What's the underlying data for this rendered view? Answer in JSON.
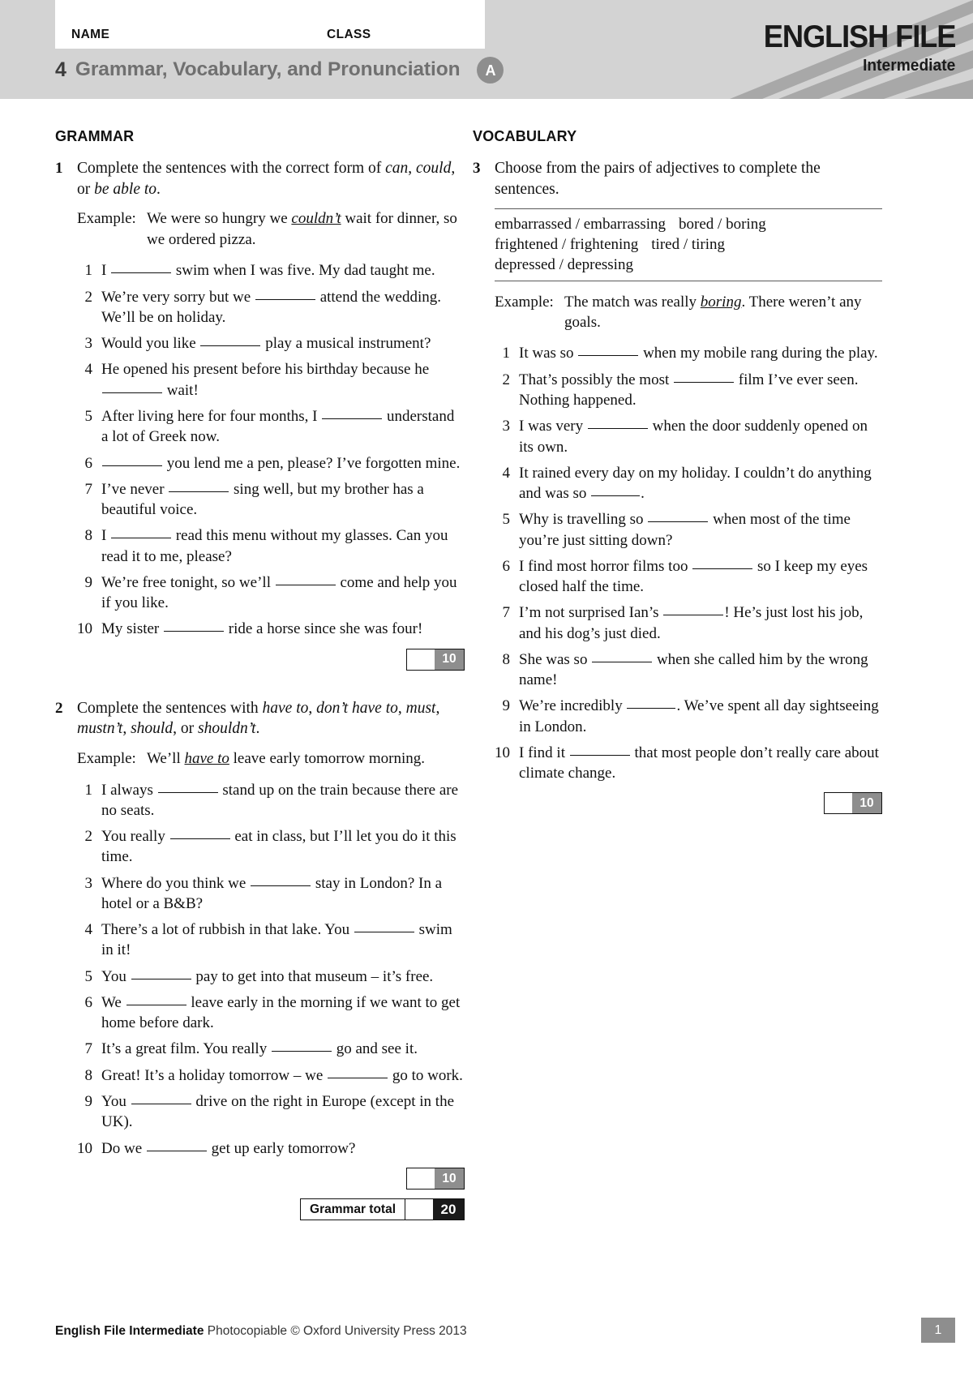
{
  "header": {
    "name_label": "NAME",
    "class_label": "CLASS",
    "unit_number": "4",
    "title": "Grammar, Vocabulary, and Pronunciation",
    "version_badge": "A",
    "brand_main": "ENGLISH FILE",
    "brand_sub": "Intermediate"
  },
  "grammar": {
    "heading": "GRAMMAR",
    "ex1": {
      "number": "1",
      "rubric_parts": [
        {
          "text": "Complete the sentences with the correct form of ",
          "italic": false
        },
        {
          "text": "can",
          "italic": true
        },
        {
          "text": ", ",
          "italic": false
        },
        {
          "text": "could",
          "italic": true
        },
        {
          "text": ", or ",
          "italic": false
        },
        {
          "text": "be able to",
          "italic": true
        },
        {
          "text": ".",
          "italic": false
        }
      ],
      "example_label": "Example:",
      "example_parts": [
        {
          "text": "We were so hungry we ",
          "underline": false
        },
        {
          "text": "couldn’t",
          "underline": true
        },
        {
          "text": " wait for dinner, so we ordered pizza.",
          "underline": false
        }
      ],
      "items": [
        {
          "n": "1",
          "parts": [
            {
              "t": "I "
            },
            {
              "blank": true
            },
            {
              "t": " swim when I was five. My dad taught me."
            }
          ]
        },
        {
          "n": "2",
          "parts": [
            {
              "t": "We’re very sorry but we "
            },
            {
              "blank": true
            },
            {
              "t": " attend the wedding. We’ll be on holiday."
            }
          ]
        },
        {
          "n": "3",
          "parts": [
            {
              "t": "Would you like "
            },
            {
              "blank": true
            },
            {
              "t": " play a musical instrument?"
            }
          ]
        },
        {
          "n": "4",
          "parts": [
            {
              "t": "He opened his present before his birthday because he "
            },
            {
              "blank": true
            },
            {
              "t": " wait!"
            }
          ]
        },
        {
          "n": "5",
          "parts": [
            {
              "t": "After living here for four months, I "
            },
            {
              "blank": true
            },
            {
              "t": " understand a lot of Greek now."
            }
          ]
        },
        {
          "n": "6",
          "parts": [
            {
              "blank": true
            },
            {
              "t": " you lend me a pen, please? I’ve forgotten mine."
            }
          ]
        },
        {
          "n": "7",
          "parts": [
            {
              "t": "I’ve never "
            },
            {
              "blank": true
            },
            {
              "t": " sing well, but my brother has a beautiful voice."
            }
          ]
        },
        {
          "n": "8",
          "parts": [
            {
              "t": "I "
            },
            {
              "blank": true
            },
            {
              "t": " read this menu without my glasses. Can you read it to me, please?"
            }
          ]
        },
        {
          "n": "9",
          "parts": [
            {
              "t": "We’re free tonight, so we’ll "
            },
            {
              "blank": true
            },
            {
              "t": " come and help you if you like."
            }
          ]
        },
        {
          "n": "10",
          "parts": [
            {
              "t": "My sister "
            },
            {
              "blank": true
            },
            {
              "t": " ride a horse since she was four!"
            }
          ]
        }
      ],
      "score": "10"
    },
    "ex2": {
      "number": "2",
      "rubric_parts": [
        {
          "text": "Complete the sentences with ",
          "italic": false
        },
        {
          "text": "have to",
          "italic": true
        },
        {
          "text": ", ",
          "italic": false
        },
        {
          "text": "don’t have to",
          "italic": true
        },
        {
          "text": ", ",
          "italic": false
        },
        {
          "text": "must",
          "italic": true
        },
        {
          "text": ", ",
          "italic": false
        },
        {
          "text": "mustn’t",
          "italic": true
        },
        {
          "text": ", ",
          "italic": false
        },
        {
          "text": "should",
          "italic": true
        },
        {
          "text": ", or ",
          "italic": false
        },
        {
          "text": "shouldn’t",
          "italic": true
        },
        {
          "text": ".",
          "italic": false
        }
      ],
      "example_label": "Example:",
      "example_parts": [
        {
          "text": "We’ll ",
          "underline": false
        },
        {
          "text": "have to",
          "underline": true
        },
        {
          "text": " leave early tomorrow morning.",
          "underline": false
        }
      ],
      "items": [
        {
          "n": "1",
          "parts": [
            {
              "t": "I always "
            },
            {
              "blank": true
            },
            {
              "t": " stand up on the train because there are no seats."
            }
          ]
        },
        {
          "n": "2",
          "parts": [
            {
              "t": "You really "
            },
            {
              "blank": true
            },
            {
              "t": " eat in class, but I’ll let you do it this time."
            }
          ]
        },
        {
          "n": "3",
          "parts": [
            {
              "t": "Where do you think we "
            },
            {
              "blank": true
            },
            {
              "t": " stay in London? In a hotel or a B&B?"
            }
          ]
        },
        {
          "n": "4",
          "parts": [
            {
              "t": "There’s a lot of rubbish in that lake. You "
            },
            {
              "blank": true
            },
            {
              "t": " swim in it!"
            }
          ]
        },
        {
          "n": "5",
          "parts": [
            {
              "t": "You "
            },
            {
              "blank": true
            },
            {
              "t": " pay to get into that museum – it’s free."
            }
          ]
        },
        {
          "n": "6",
          "parts": [
            {
              "t": "We "
            },
            {
              "blank": true
            },
            {
              "t": " leave early in the morning if we want to get home before dark."
            }
          ]
        },
        {
          "n": "7",
          "parts": [
            {
              "t": "It’s a great film. You really "
            },
            {
              "blank": true
            },
            {
              "t": " go and see it."
            }
          ]
        },
        {
          "n": "8",
          "parts": [
            {
              "t": "Great! It’s a holiday tomorrow – we "
            },
            {
              "blank": true
            },
            {
              "t": " go to work."
            }
          ]
        },
        {
          "n": "9",
          "parts": [
            {
              "t": "You "
            },
            {
              "blank": true
            },
            {
              "t": " drive on the right in Europe (except in the UK)."
            }
          ]
        },
        {
          "n": "10",
          "parts": [
            {
              "t": "Do we "
            },
            {
              "blank": true
            },
            {
              "t": " get up early tomorrow?"
            }
          ]
        }
      ],
      "score": "10"
    },
    "total_label": "Grammar total",
    "total_score": "20"
  },
  "vocabulary": {
    "heading": "VOCABULARY",
    "ex3": {
      "number": "3",
      "rubric_parts": [
        {
          "text": "Choose from the pairs of adjectives to complete the sentences.",
          "italic": false
        }
      ],
      "wordbank_lines": [
        [
          "embarrassed / embarrassing",
          "bored / boring"
        ],
        [
          "frightened / frightening",
          "tired / tiring"
        ],
        [
          "depressed / depressing"
        ]
      ],
      "example_label": "Example:",
      "example_parts": [
        {
          "text": "The match was really ",
          "underline": false
        },
        {
          "text": "boring",
          "underline": true
        },
        {
          "text": ". There weren’t any goals.",
          "underline": false
        }
      ],
      "items": [
        {
          "n": "1",
          "parts": [
            {
              "t": "It was so "
            },
            {
              "blank": true
            },
            {
              "t": " when my mobile rang during the play."
            }
          ]
        },
        {
          "n": "2",
          "parts": [
            {
              "t": "That’s possibly the most "
            },
            {
              "blank": true
            },
            {
              "t": " film I’ve ever seen. Nothing happened."
            }
          ]
        },
        {
          "n": "3",
          "parts": [
            {
              "t": "I was very "
            },
            {
              "blank": true
            },
            {
              "t": " when the door suddenly opened on its own."
            }
          ]
        },
        {
          "n": "4",
          "parts": [
            {
              "t": "It rained every day on my holiday. I couldn’t do anything and was so "
            },
            {
              "blank": "short"
            },
            {
              "t": "."
            }
          ]
        },
        {
          "n": "5",
          "parts": [
            {
              "t": "Why is travelling so "
            },
            {
              "blank": true
            },
            {
              "t": " when most of the time you’re just sitting down?"
            }
          ]
        },
        {
          "n": "6",
          "parts": [
            {
              "t": "I find most horror films too "
            },
            {
              "blank": true
            },
            {
              "t": " so I keep my eyes closed half the time."
            }
          ]
        },
        {
          "n": "7",
          "parts": [
            {
              "t": "I’m not surprised Ian’s "
            },
            {
              "blank": true
            },
            {
              "t": "! He’s just lost his job, and his dog’s just died."
            }
          ]
        },
        {
          "n": "8",
          "parts": [
            {
              "t": "She was so "
            },
            {
              "blank": true
            },
            {
              "t": " when she called him by the wrong name!"
            }
          ]
        },
        {
          "n": "9",
          "parts": [
            {
              "t": "We’re incredibly "
            },
            {
              "blank": "short"
            },
            {
              "t": ". We’ve spent all day sightseeing in London."
            }
          ]
        },
        {
          "n": "10",
          "parts": [
            {
              "t": "I find it "
            },
            {
              "blank": true
            },
            {
              "t": " that most people don’t really care about climate change."
            }
          ]
        }
      ],
      "score": "10"
    }
  },
  "footer": {
    "bold_text": "English File Intermediate",
    "rest_text": " Photocopiable © Oxford University Press 2013",
    "page_number": "1"
  },
  "colors": {
    "header_bg": "#d3d3d3",
    "ray": "#a8a8a8",
    "badge_gray": "#8e8e8e",
    "rule": "#5a5a5a"
  }
}
